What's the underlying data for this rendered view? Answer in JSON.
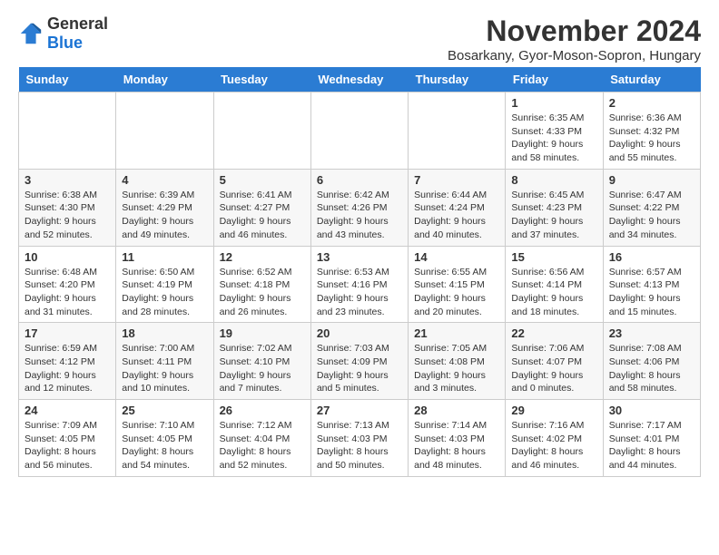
{
  "header": {
    "logo_general": "General",
    "logo_blue": "Blue",
    "month_year": "November 2024",
    "location": "Bosarkany, Gyor-Moson-Sopron, Hungary"
  },
  "days_of_week": [
    "Sunday",
    "Monday",
    "Tuesday",
    "Wednesday",
    "Thursday",
    "Friday",
    "Saturday"
  ],
  "weeks": [
    [
      {
        "day": "",
        "content": ""
      },
      {
        "day": "",
        "content": ""
      },
      {
        "day": "",
        "content": ""
      },
      {
        "day": "",
        "content": ""
      },
      {
        "day": "",
        "content": ""
      },
      {
        "day": "1",
        "content": "Sunrise: 6:35 AM\nSunset: 4:33 PM\nDaylight: 9 hours and 58 minutes."
      },
      {
        "day": "2",
        "content": "Sunrise: 6:36 AM\nSunset: 4:32 PM\nDaylight: 9 hours and 55 minutes."
      }
    ],
    [
      {
        "day": "3",
        "content": "Sunrise: 6:38 AM\nSunset: 4:30 PM\nDaylight: 9 hours and 52 minutes."
      },
      {
        "day": "4",
        "content": "Sunrise: 6:39 AM\nSunset: 4:29 PM\nDaylight: 9 hours and 49 minutes."
      },
      {
        "day": "5",
        "content": "Sunrise: 6:41 AM\nSunset: 4:27 PM\nDaylight: 9 hours and 46 minutes."
      },
      {
        "day": "6",
        "content": "Sunrise: 6:42 AM\nSunset: 4:26 PM\nDaylight: 9 hours and 43 minutes."
      },
      {
        "day": "7",
        "content": "Sunrise: 6:44 AM\nSunset: 4:24 PM\nDaylight: 9 hours and 40 minutes."
      },
      {
        "day": "8",
        "content": "Sunrise: 6:45 AM\nSunset: 4:23 PM\nDaylight: 9 hours and 37 minutes."
      },
      {
        "day": "9",
        "content": "Sunrise: 6:47 AM\nSunset: 4:22 PM\nDaylight: 9 hours and 34 minutes."
      }
    ],
    [
      {
        "day": "10",
        "content": "Sunrise: 6:48 AM\nSunset: 4:20 PM\nDaylight: 9 hours and 31 minutes."
      },
      {
        "day": "11",
        "content": "Sunrise: 6:50 AM\nSunset: 4:19 PM\nDaylight: 9 hours and 28 minutes."
      },
      {
        "day": "12",
        "content": "Sunrise: 6:52 AM\nSunset: 4:18 PM\nDaylight: 9 hours and 26 minutes."
      },
      {
        "day": "13",
        "content": "Sunrise: 6:53 AM\nSunset: 4:16 PM\nDaylight: 9 hours and 23 minutes."
      },
      {
        "day": "14",
        "content": "Sunrise: 6:55 AM\nSunset: 4:15 PM\nDaylight: 9 hours and 20 minutes."
      },
      {
        "day": "15",
        "content": "Sunrise: 6:56 AM\nSunset: 4:14 PM\nDaylight: 9 hours and 18 minutes."
      },
      {
        "day": "16",
        "content": "Sunrise: 6:57 AM\nSunset: 4:13 PM\nDaylight: 9 hours and 15 minutes."
      }
    ],
    [
      {
        "day": "17",
        "content": "Sunrise: 6:59 AM\nSunset: 4:12 PM\nDaylight: 9 hours and 12 minutes."
      },
      {
        "day": "18",
        "content": "Sunrise: 7:00 AM\nSunset: 4:11 PM\nDaylight: 9 hours and 10 minutes."
      },
      {
        "day": "19",
        "content": "Sunrise: 7:02 AM\nSunset: 4:10 PM\nDaylight: 9 hours and 7 minutes."
      },
      {
        "day": "20",
        "content": "Sunrise: 7:03 AM\nSunset: 4:09 PM\nDaylight: 9 hours and 5 minutes."
      },
      {
        "day": "21",
        "content": "Sunrise: 7:05 AM\nSunset: 4:08 PM\nDaylight: 9 hours and 3 minutes."
      },
      {
        "day": "22",
        "content": "Sunrise: 7:06 AM\nSunset: 4:07 PM\nDaylight: 9 hours and 0 minutes."
      },
      {
        "day": "23",
        "content": "Sunrise: 7:08 AM\nSunset: 4:06 PM\nDaylight: 8 hours and 58 minutes."
      }
    ],
    [
      {
        "day": "24",
        "content": "Sunrise: 7:09 AM\nSunset: 4:05 PM\nDaylight: 8 hours and 56 minutes."
      },
      {
        "day": "25",
        "content": "Sunrise: 7:10 AM\nSunset: 4:05 PM\nDaylight: 8 hours and 54 minutes."
      },
      {
        "day": "26",
        "content": "Sunrise: 7:12 AM\nSunset: 4:04 PM\nDaylight: 8 hours and 52 minutes."
      },
      {
        "day": "27",
        "content": "Sunrise: 7:13 AM\nSunset: 4:03 PM\nDaylight: 8 hours and 50 minutes."
      },
      {
        "day": "28",
        "content": "Sunrise: 7:14 AM\nSunset: 4:03 PM\nDaylight: 8 hours and 48 minutes."
      },
      {
        "day": "29",
        "content": "Sunrise: 7:16 AM\nSunset: 4:02 PM\nDaylight: 8 hours and 46 minutes."
      },
      {
        "day": "30",
        "content": "Sunrise: 7:17 AM\nSunset: 4:01 PM\nDaylight: 8 hours and 44 minutes."
      }
    ]
  ]
}
